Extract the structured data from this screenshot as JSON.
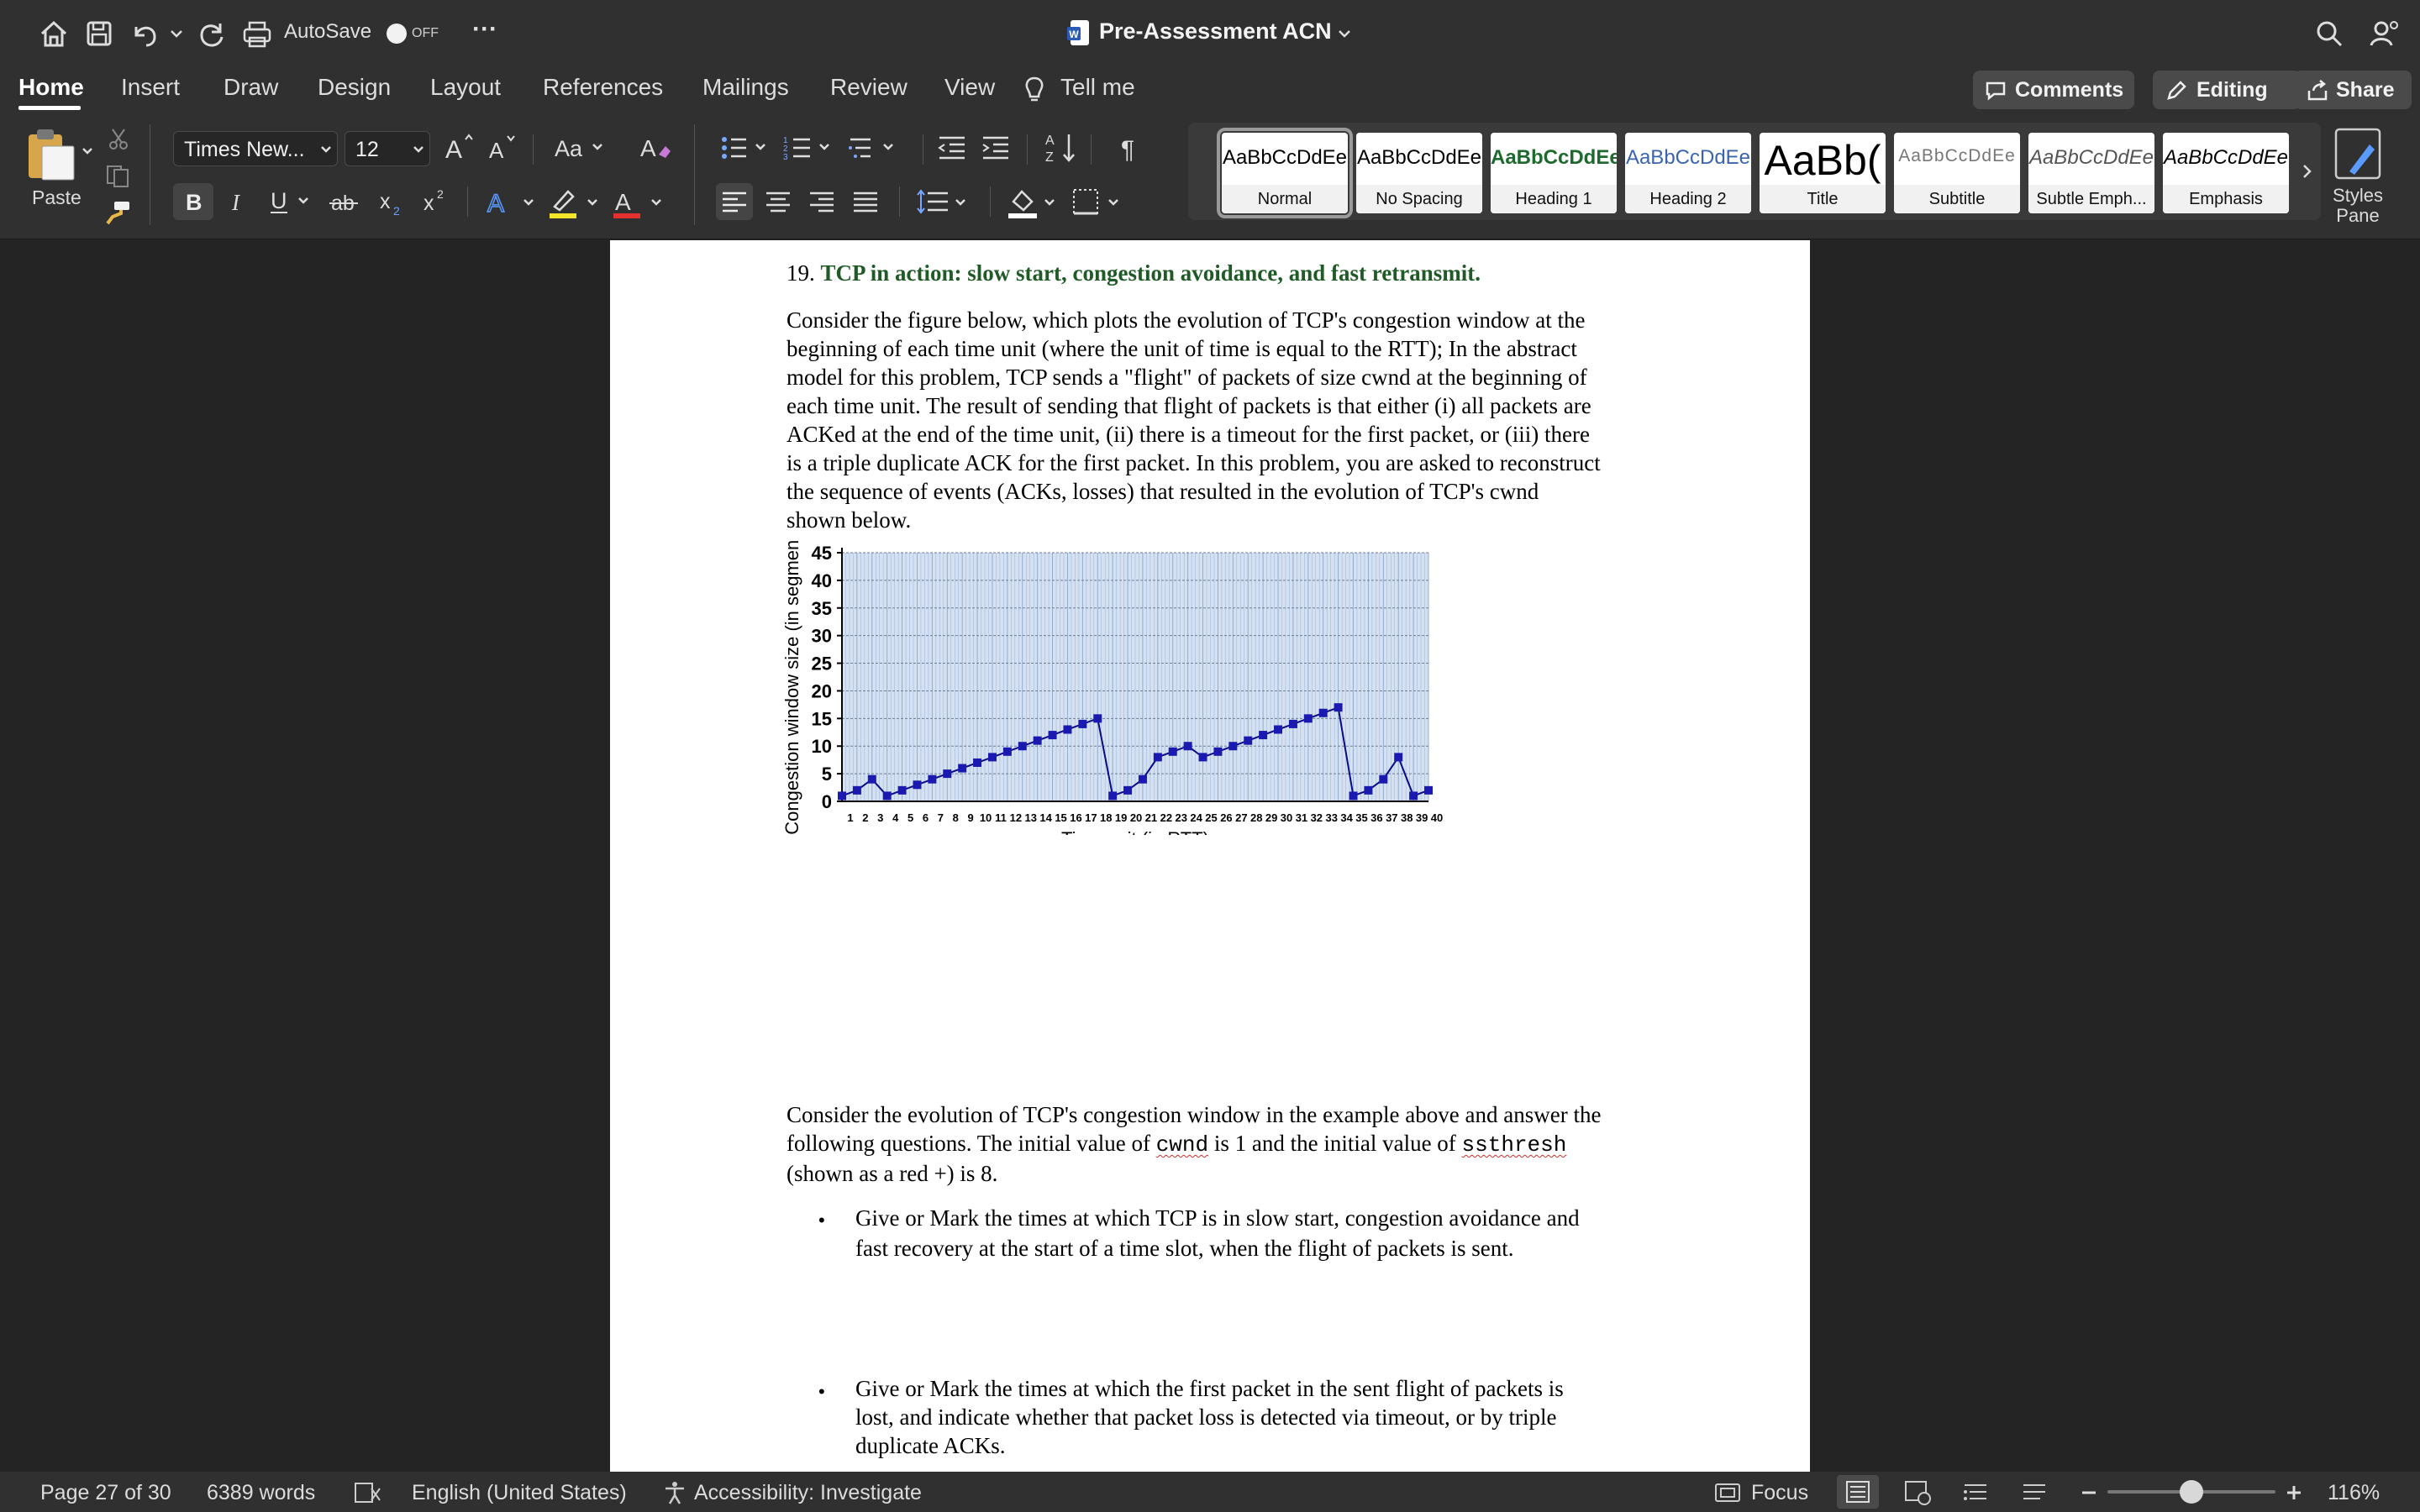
{
  "titlebar": {
    "autosave_label": "AutoSave",
    "autosave_state": "OFF",
    "more": "···",
    "doc_title": "Pre-Assessment ACN"
  },
  "tabs": [
    "Home",
    "Insert",
    "Draw",
    "Design",
    "Layout",
    "References",
    "Mailings",
    "Review",
    "View"
  ],
  "tell_me": "Tell me",
  "actions": {
    "comments": "Comments",
    "editing": "Editing",
    "share": "Share"
  },
  "ribbon": {
    "paste": "Paste",
    "font_name": "Times New...",
    "font_size": "12",
    "styles_pane": [
      "Styles",
      "Pane"
    ],
    "styles": [
      {
        "preview": "AaBbCcDdEe",
        "label": "Normal"
      },
      {
        "preview": "AaBbCcDdEe",
        "label": "No Spacing"
      },
      {
        "preview": "AaBbCcDdEe",
        "label": "Heading 1"
      },
      {
        "preview": "AaBbCcDdEe",
        "label": "Heading 2"
      },
      {
        "preview": "AaBb(",
        "label": "Title"
      },
      {
        "preview": "AaBbCcDdEe",
        "label": "Subtitle"
      },
      {
        "preview": "AaBbCcDdEe",
        "label": "Subtle Emph..."
      },
      {
        "preview": "AaBbCcDdEe",
        "label": "Emphasis"
      }
    ]
  },
  "document": {
    "q_number": "19.",
    "q_title": "TCP in action: slow start, congestion avoidance, and fast retransmit.",
    "para1_lines": [
      "Consider the figure below, which plots the evolution of TCP's congestion window at the",
      "beginning of each time unit (where the unit of time is equal to the RTT); In the abstract",
      "model for this problem, TCP sends a \"flight\" of packets of size cwnd at the beginning of",
      "each time unit. The result of sending that flight of packets is that either (i) all packets are",
      "ACKed at the end of the time unit, (ii) there is a timeout for the first packet, or (iii) there",
      "is a triple duplicate ACK for the first packet. In this problem, you are asked to reconstruct",
      "the sequence of events (ACKs, losses) that resulted in the evolution of TCP's cwnd",
      "shown below."
    ],
    "para2_line1": "Consider the evolution of TCP's congestion window in the example above and answer the",
    "para2_line2a": "following questions. The initial value of ",
    "para2_code1": "cwnd",
    "para2_line2b": " is 1 and the initial value of ",
    "para2_code2": "ssthresh",
    "para2_line3": "(shown as a red +) is 8.",
    "bullet1": [
      "Give or Mark the times at which TCP is in slow start, congestion avoidance and",
      "fast recovery at the start of a time slot, when the flight of packets is sent."
    ],
    "bullet2": [
      "Give or Mark the times at which the first packet in the sent flight of packets is",
      "lost, and indicate whether that packet loss is detected via timeout, or by triple",
      "duplicate ACKs."
    ]
  },
  "chart_data": {
    "type": "line",
    "xlabel": "Time unit (in RTT)",
    "ylabel": "Congestion window size (in segments)",
    "x": [
      1,
      2,
      3,
      4,
      5,
      6,
      7,
      8,
      9,
      10,
      11,
      12,
      13,
      14,
      15,
      16,
      17,
      18,
      19,
      20,
      21,
      22,
      23,
      24,
      25,
      26,
      27,
      28,
      29,
      30,
      31,
      32,
      33,
      34,
      35,
      36,
      37,
      38,
      39
    ],
    "values": [
      1,
      2,
      4,
      1,
      2,
      3,
      4,
      5,
      6,
      7,
      8,
      9,
      10,
      11,
      12,
      13,
      14,
      15,
      1,
      2,
      4,
      8,
      9,
      10,
      8,
      9,
      10,
      11,
      12,
      13,
      14,
      15,
      16,
      17,
      1,
      2,
      4,
      8,
      1,
      2
    ],
    "x_ticks": [
      1,
      2,
      3,
      4,
      5,
      6,
      7,
      8,
      9,
      10,
      11,
      12,
      13,
      14,
      15,
      16,
      17,
      18,
      19,
      20,
      21,
      22,
      23,
      24,
      25,
      26,
      27,
      28,
      29,
      30,
      31,
      32,
      33,
      34,
      35,
      36,
      37,
      38,
      39,
      40
    ],
    "y_ticks": [
      0,
      5,
      10,
      15,
      20,
      25,
      30,
      35,
      40,
      45
    ],
    "xlim": [
      1,
      40
    ],
    "ylim": [
      0,
      45
    ],
    "grid": true,
    "colors": {
      "line": "#0b0b8a",
      "marker": "#1a1ab0",
      "plot_bg": "#d4e1f2",
      "grid": "#8fa6c8"
    }
  },
  "statusbar": {
    "page": "Page 27 of 30",
    "words": "6389 words",
    "language": "English (United States)",
    "accessibility": "Accessibility: Investigate",
    "focus": "Focus",
    "zoom": "116%"
  }
}
